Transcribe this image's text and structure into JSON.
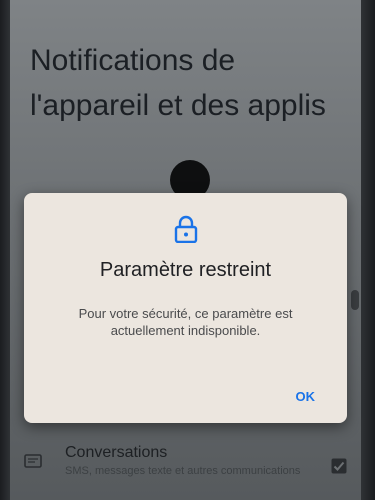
{
  "page": {
    "title": "Notifications de l'appareil et des applis"
  },
  "dialog": {
    "icon": "lock-icon",
    "title": "Paramètre restreint",
    "message": "Pour votre sécurité, ce paramètre est actuellement indisponible.",
    "ok_label": "OK",
    "accent_color": "#1a73e8"
  },
  "list": {
    "items": [
      {
        "icon": "message-icon",
        "title": "Conversations",
        "subtitle": "SMS, messages texte et autres communications",
        "checked": true
      }
    ]
  }
}
